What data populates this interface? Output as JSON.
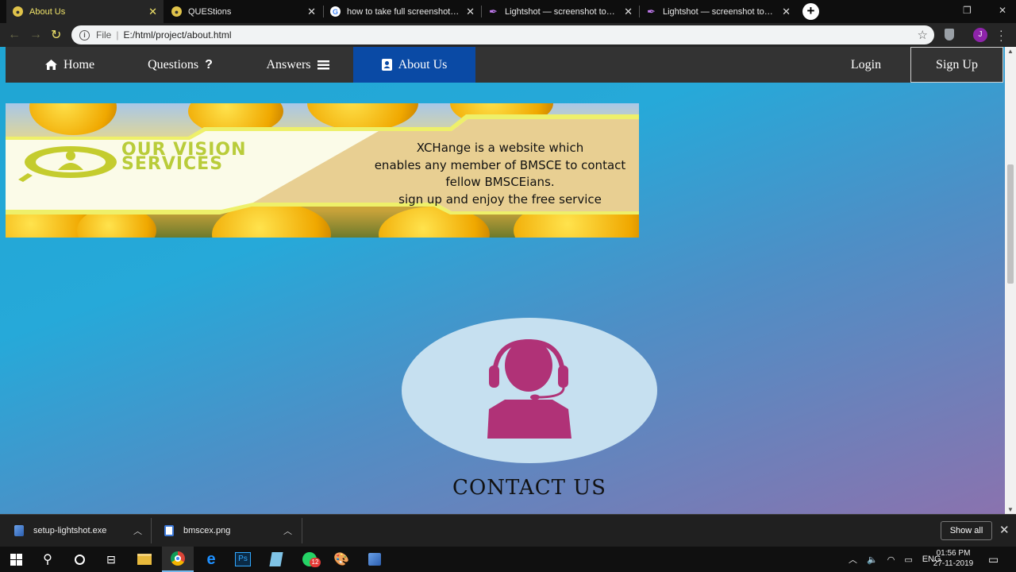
{
  "browser": {
    "tabs": [
      {
        "title": "About Us",
        "favicon": "chrome-favicon",
        "active": true
      },
      {
        "title": "QUEStions",
        "favicon": "chrome-favicon",
        "active": false
      },
      {
        "title": "how to take full screenshot in wir",
        "favicon": "google-favicon",
        "active": false
      },
      {
        "title": "Lightshot — screenshot tool for M",
        "favicon": "lightshot-favicon",
        "active": false
      },
      {
        "title": "Lightshot — screenshot tool for M",
        "favicon": "lightshot-favicon",
        "active": false
      }
    ],
    "address": {
      "scheme": "File",
      "url": "E:/html/project/about.html"
    },
    "profile_initial": "J"
  },
  "site_nav": {
    "home": "Home",
    "questions": "Questions",
    "answers": "Answers",
    "about": "About Us",
    "login": "Login",
    "signup": "Sign Up"
  },
  "banner": {
    "vision_line1": "OUR VISION",
    "vision_line2": "SERVICES",
    "desc_lines": [
      "XCHange is a website which",
      "enables any member of BMSCE to contact",
      "fellow BMSCEians.",
      "sign up and enjoy the free service"
    ]
  },
  "contact": {
    "title": "CONTACT US",
    "icon": "support-agent-icon",
    "icon_color": "#b03277"
  },
  "downloads": {
    "items": [
      {
        "name": "setup-lightshot.exe",
        "icon": "installer-file-icon"
      },
      {
        "name": "bmscex.png",
        "icon": "image-file-icon"
      }
    ],
    "show_all": "Show all"
  },
  "taskbar": {
    "lang": "ENG",
    "time": "01:56 PM",
    "date": "27-11-2019",
    "whatsapp_badge": "12"
  },
  "colors": {
    "nav_bg": "#333333",
    "nav_active": "#0a4aa5",
    "accent_yellow": "#f0e36a"
  }
}
